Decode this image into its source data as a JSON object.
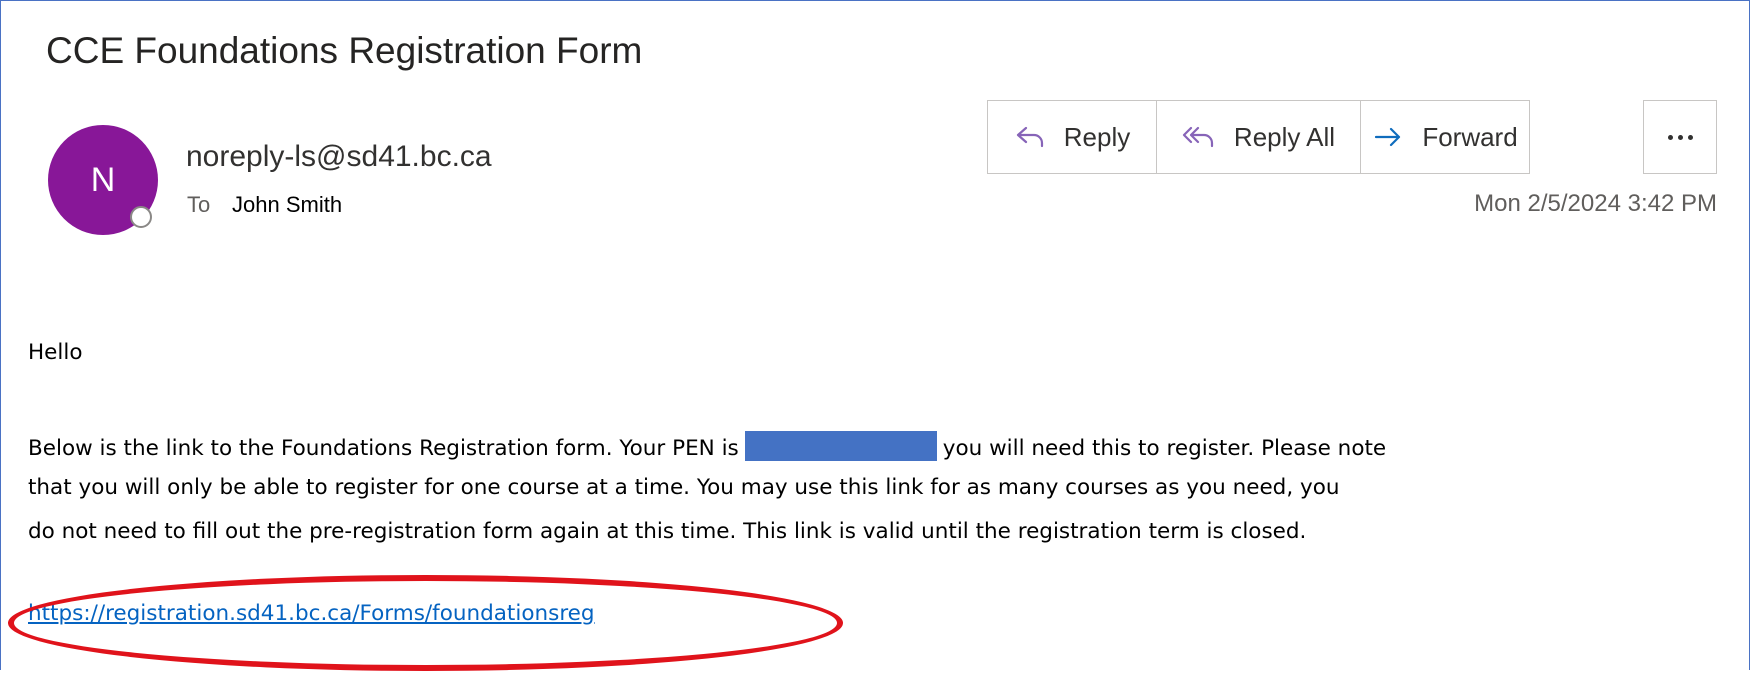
{
  "email": {
    "subject": "CCE Foundations Registration Form",
    "avatar_initial": "N",
    "avatar_color": "#881798",
    "sender": "noreply-ls@sd41.bc.ca",
    "to_label": "To",
    "to_name": "John Smith",
    "date": "Mon 2/5/2024 3:42 PM"
  },
  "toolbar": {
    "reply_label": "Reply",
    "reply_all_label": "Reply All",
    "forward_label": "Forward",
    "reply_icon": "reply-arrow-icon",
    "reply_all_icon": "reply-all-arrow-icon",
    "forward_icon": "forward-arrow-icon",
    "more_icon": "more-options-icon",
    "icon_color": "#8764b8",
    "forward_icon_color": "#0f6cbd"
  },
  "body": {
    "greeting": "Hello",
    "line1_before": "Below is the link to the Foundations Registration form. Your PEN is",
    "line1_after": "you will need this to register. Please note",
    "line2": "that you will only be able to register for one course at a time. You may use this link for as many courses as you need, you",
    "line3": "do not need to fill out the pre-registration form again at this time. This link is valid until the registration term is closed.",
    "link": "https://registration.sd41.bc.ca/Forms/foundationsreg",
    "redaction_color": "#4472c4",
    "annotation_color": "#e0131b"
  }
}
